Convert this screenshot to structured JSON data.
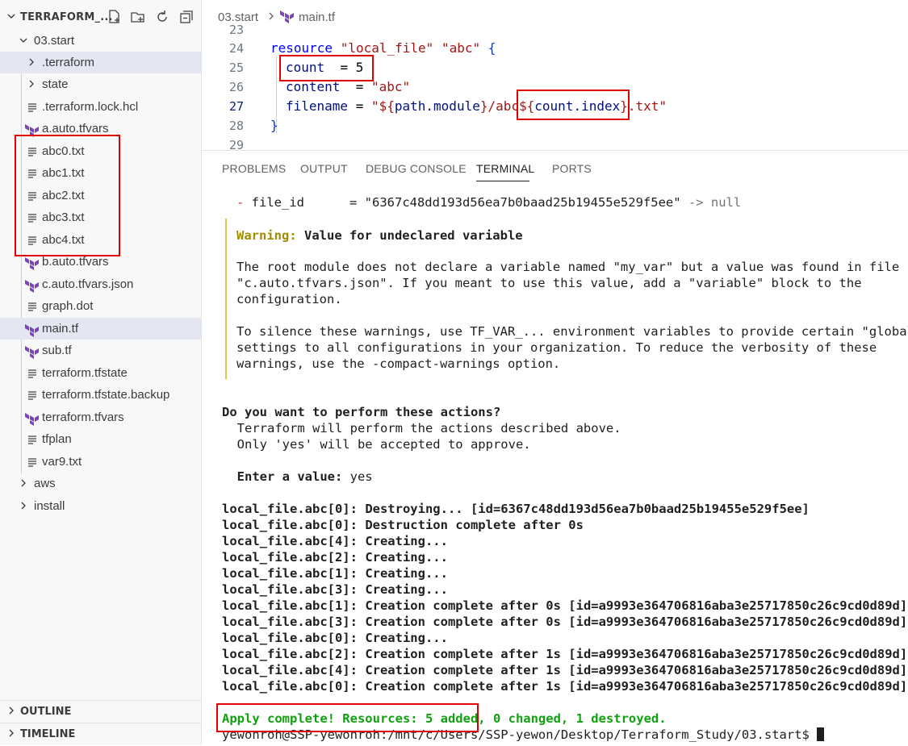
{
  "explorer": {
    "title": "TERRAFORM_...",
    "items": [
      {
        "label": "03.start",
        "kind": "folder-open"
      },
      {
        "label": ".terraform",
        "kind": "folder"
      },
      {
        "label": "state",
        "kind": "folder"
      },
      {
        "label": ".terraform.lock.hcl",
        "kind": "file"
      },
      {
        "label": "a.auto.tfvars",
        "kind": "terraform"
      },
      {
        "label": "abc0.txt",
        "kind": "file"
      },
      {
        "label": "abc1.txt",
        "kind": "file"
      },
      {
        "label": "abc2.txt",
        "kind": "file"
      },
      {
        "label": "abc3.txt",
        "kind": "file"
      },
      {
        "label": "abc4.txt",
        "kind": "file"
      },
      {
        "label": "b.auto.tfvars",
        "kind": "terraform"
      },
      {
        "label": "c.auto.tfvars.json",
        "kind": "terraform"
      },
      {
        "label": "graph.dot",
        "kind": "file"
      },
      {
        "label": "main.tf",
        "kind": "terraform"
      },
      {
        "label": "sub.tf",
        "kind": "terraform"
      },
      {
        "label": "terraform.tfstate",
        "kind": "file"
      },
      {
        "label": "terraform.tfstate.backup",
        "kind": "file"
      },
      {
        "label": "terraform.tfvars",
        "kind": "terraform"
      },
      {
        "label": "tfplan",
        "kind": "file"
      },
      {
        "label": "var9.txt",
        "kind": "file"
      },
      {
        "label": "aws",
        "kind": "folder"
      },
      {
        "label": "install",
        "kind": "folder"
      }
    ],
    "outline_label": "OUTLINE",
    "timeline_label": "TIMELINE"
  },
  "breadcrumb": {
    "folder": "03.start",
    "file": "main.tf"
  },
  "editor": {
    "line_numbers": [
      "23",
      "24",
      "25",
      "26",
      "27",
      "28",
      "29"
    ],
    "line24": {
      "kw": "resource",
      "s1": "\"local_file\"",
      "s2": "\"abc\"",
      "brace": "{"
    },
    "line25": {
      "ident": "count",
      "eq": "  = ",
      "num": "5"
    },
    "line26": {
      "ident": "content",
      "eq": "  = ",
      "str": "\"abc\""
    },
    "line27": {
      "ident": "filename",
      "eq": " = ",
      "s1": "\"${",
      "expr1": "path.module",
      "s2": "}/abc",
      "s3": "${",
      "expr2": "count.index",
      "s4": "}",
      "s5": ".txt\""
    },
    "line28": {
      "brace": "}"
    }
  },
  "panel": {
    "tabs": [
      "PROBLEMS",
      "OUTPUT",
      "DEBUG CONSOLE",
      "TERMINAL",
      "PORTS"
    ],
    "active_tab": "TERMINAL"
  },
  "terminal": {
    "file_id_line": {
      "dash": "- ",
      "key": "file_id",
      "pad": "      = ",
      "val": "\"6367c48dd193d56ea7b0baad25b19455e529f5ee\"",
      "arrow": " -> null"
    },
    "warning_label": "Warning:",
    "warning_title": " Value for undeclared variable",
    "warning_body": [
      "The root module does not declare a variable named \"my_var\" but a value was found in file",
      "\"c.auto.tfvars.json\". If you meant to use this value, add a \"variable\" block to the",
      "configuration.",
      "",
      "To silence these warnings, use TF_VAR_... environment variables to provide certain \"global\"",
      "settings to all configurations in your organization. To reduce the verbosity of these",
      "warnings, use the -compact-warnings option."
    ],
    "prompt_title": "Do you want to perform these actions?",
    "prompt_lines": [
      "  Terraform will perform the actions described above.",
      "  Only 'yes' will be accepted to approve."
    ],
    "enter_label": "  Enter a value:",
    "enter_value": " yes",
    "log_lines": [
      {
        "res": "local_file.abc[0]:",
        "msg": " Destroying... [id=6367c48dd193d56ea7b0baad25b19455e529f5ee]"
      },
      {
        "res": "local_file.abc[0]:",
        "msg": " Destruction complete after 0s"
      },
      {
        "res": "local_file.abc[4]:",
        "msg": " Creating..."
      },
      {
        "res": "local_file.abc[2]:",
        "msg": " Creating..."
      },
      {
        "res": "local_file.abc[1]:",
        "msg": " Creating..."
      },
      {
        "res": "local_file.abc[3]:",
        "msg": " Creating..."
      },
      {
        "res": "local_file.abc[1]:",
        "msg": " Creation complete after 0s [id=a9993e364706816aba3e25717850c26c9cd0d89d]"
      },
      {
        "res": "local_file.abc[3]:",
        "msg": " Creation complete after 0s [id=a9993e364706816aba3e25717850c26c9cd0d89d]"
      },
      {
        "res": "local_file.abc[0]:",
        "msg": " Creating..."
      },
      {
        "res": "local_file.abc[2]:",
        "msg": " Creation complete after 1s [id=a9993e364706816aba3e25717850c26c9cd0d89d]"
      },
      {
        "res": "local_file.abc[4]:",
        "msg": " Creation complete after 1s [id=a9993e364706816aba3e25717850c26c9cd0d89d]"
      },
      {
        "res": "local_file.abc[0]:",
        "msg": " Creation complete after 1s [id=a9993e364706816aba3e25717850c26c9cd0d89d]"
      }
    ],
    "apply_line": "Apply complete! Resources: 5 added, 0 changed, 1 destroyed.",
    "shell_prompt": "yewonroh@SSP-yewonroh:/mnt/c/Users/SSP-yewon/Desktop/Terraform_Study/03.start$ "
  },
  "colors": {
    "terraform_icon": "#7b42bc",
    "highlight_box": "#e00000"
  }
}
